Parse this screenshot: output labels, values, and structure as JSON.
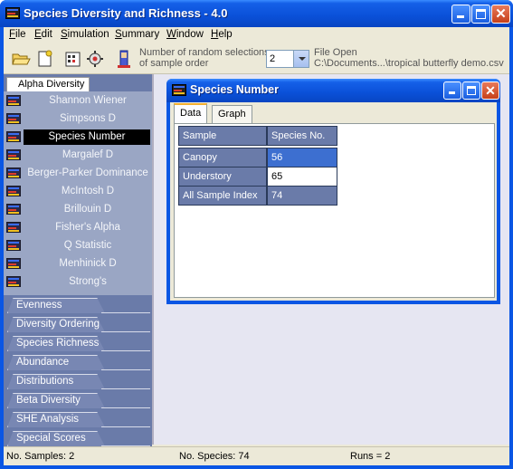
{
  "window": {
    "title": "Species Diversity and Richness - 4.0"
  },
  "menu": [
    {
      "label": "File",
      "u": "F",
      "rest": "ile"
    },
    {
      "label": "Edit",
      "u": "E",
      "rest": "dit"
    },
    {
      "label": "Simulation",
      "u": "S",
      "rest": "imulation"
    },
    {
      "label": "Summary",
      "u": "S",
      "rest": "ummary"
    },
    {
      "label": "Window",
      "u": "W",
      "rest": "indow"
    },
    {
      "label": "Help",
      "u": "H",
      "rest": "elp"
    }
  ],
  "toolbar": {
    "selections_label_1": "Number of random selections",
    "selections_label_2": "of sample order",
    "selections_value": "2",
    "file_status": "File Open",
    "file_path": "C:\\Documents...\\tropical butterfly demo.csv"
  },
  "left_panel": {
    "alpha_tab": "Alpha Diversity",
    "alpha_items": [
      "Shannon Wiener",
      "Simpsons D",
      "Species Number",
      "Margalef D",
      "Berger-Parker Dominance",
      "McIntosh D",
      "Brillouin D",
      "Fisher's Alpha",
      "Q Statistic",
      "Menhinick D",
      "Strong's"
    ],
    "active_item": "Species Number",
    "groups": [
      "Evenness",
      "Diversity Ordering",
      "Species Richness",
      "Abundance",
      "Distributions",
      "Beta Diversity",
      "SHE Analysis",
      "Special Scores"
    ]
  },
  "child_window": {
    "title": "Species Number",
    "tabs": [
      "Data",
      "Graph"
    ],
    "active_tab": "Data",
    "table": {
      "headers": [
        "Sample",
        "Species No."
      ],
      "rows": [
        {
          "sample": "Canopy",
          "value": "56"
        },
        {
          "sample": "Understory",
          "value": "65"
        },
        {
          "sample": "All Sample Index",
          "value": "74"
        }
      ]
    }
  },
  "status": {
    "samples": "No. Samples: 2",
    "species": "No. Species: 74",
    "runs": "Runs = 2"
  },
  "colors": {
    "titlebar": "#0a50d8",
    "panel": "#6a7ba9",
    "selection": "#3d6fd0"
  }
}
